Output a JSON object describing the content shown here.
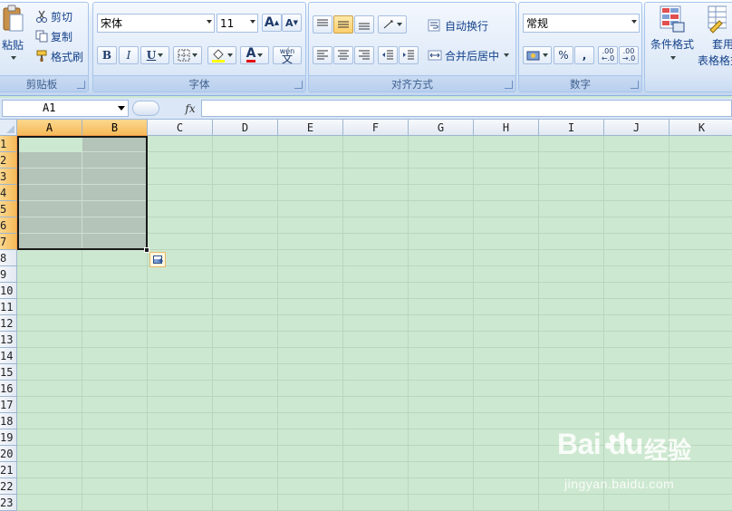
{
  "ribbon": {
    "clipboard": {
      "paste_label": "粘贴",
      "cut_label": "剪切",
      "copy_label": "复制",
      "format_painter_label": "格式刷",
      "group_label": "剪贴板"
    },
    "font": {
      "font_name": "宋体",
      "font_size": "11",
      "grow_label": "A",
      "shrink_label": "A",
      "bold_label": "B",
      "italic_label": "I",
      "underline_label": "U",
      "font_color_label": "A",
      "phonetic_label": "文",
      "phonetic_top_label": "wén",
      "group_label": "字体"
    },
    "alignment": {
      "wrap_text_label": "自动换行",
      "merge_center_label": "合并后居中",
      "group_label": "对齐方式"
    },
    "number": {
      "format": "常规",
      "percent_label": "%",
      "comma_label": ",",
      "inc_decimal_label": ".00",
      "dec_decimal_label": ".00",
      "group_label": "数字"
    },
    "styles": {
      "conditional_format_label": "条件格式",
      "format_as_table_label_1": "套用",
      "format_as_table_label_2": "表格格式"
    }
  },
  "formula_bar": {
    "name_box": "A1",
    "fx_label": "fx",
    "formula": ""
  },
  "sheet": {
    "columns": [
      "A",
      "B",
      "C",
      "D",
      "E",
      "F",
      "G",
      "H",
      "I",
      "J",
      "K"
    ],
    "rows": [
      "1",
      "2",
      "3",
      "4",
      "5",
      "6",
      "7",
      "8",
      "9",
      "10",
      "11",
      "12",
      "13",
      "14",
      "15",
      "16",
      "17",
      "18",
      "19",
      "20",
      "21",
      "22",
      "23"
    ],
    "selected_columns": [
      "A",
      "B"
    ],
    "selected_rows": [
      "1",
      "2",
      "3",
      "4",
      "5",
      "6",
      "7"
    ],
    "selection_range": "A1:B7"
  },
  "watermark": {
    "logo": "Bai du",
    "brand": "经验",
    "url": "jingyan.baidu.com"
  },
  "colors": {
    "sheet_background": "#cde8d0",
    "selection_fill": "#b4c4b8",
    "header_highlight": "#f6b958",
    "ribbon_text": "#15428b"
  }
}
